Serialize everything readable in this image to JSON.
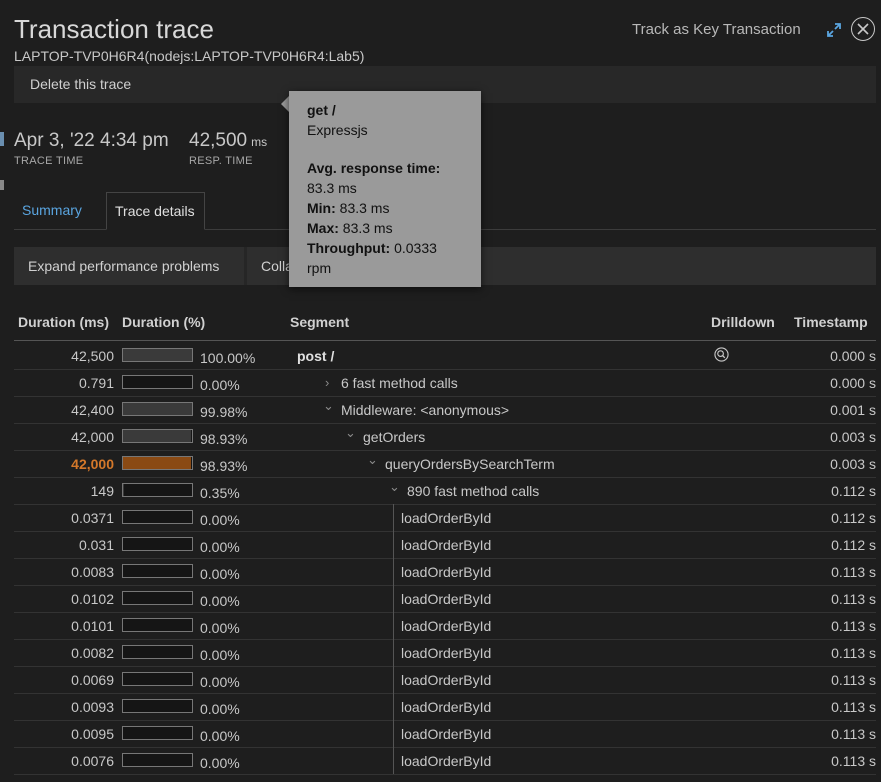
{
  "header": {
    "title": "Transaction trace",
    "subtitle": "LAPTOP-TVP0H6R4(nodejs:LAPTOP-TVP0H6R4:Lab5)",
    "track_label": "Track as Key Transaction",
    "delete_label": "Delete this trace"
  },
  "stats": {
    "trace_time": "Apr 3, '22 4:34 pm",
    "trace_time_label": "TRACE TIME",
    "resp_time": "42,500",
    "resp_time_unit": "ms",
    "resp_time_label": "RESP. TIME"
  },
  "tabs": {
    "summary": "Summary",
    "details": "Trace details"
  },
  "buttons": {
    "expand_perf": "Expand performance problems",
    "collapse": "Colla"
  },
  "columns": {
    "duration_ms": "Duration (ms)",
    "duration_pct": "Duration (%)",
    "segment": "Segment",
    "drilldown": "Drilldown",
    "timestamp": "Timestamp"
  },
  "tooltip": {
    "name": "get /",
    "framework": "Expressjs",
    "avg_label": "Avg. response time",
    "avg_value": "83.3 ms",
    "min_label": "Min",
    "min_value": "83.3 ms",
    "max_label": "Max",
    "max_value": "83.3 ms",
    "throughput_label": "Throughput",
    "throughput_value": "0.0333",
    "throughput_unit": "rpm"
  },
  "rows": [
    {
      "duration": "42,500",
      "pct": "100.00%",
      "fill": 1.0,
      "segment": "post /",
      "level": 0,
      "chevron": "",
      "bold": true,
      "drilldown": true,
      "timestamp": "0.000  s"
    },
    {
      "duration": "0.791",
      "pct": "0.00%",
      "fill": 0.0,
      "segment": "6 fast method calls",
      "level": 1,
      "chevron": "›",
      "timestamp": "0.000  s"
    },
    {
      "duration": "42,400",
      "pct": "99.98%",
      "fill": 0.9998,
      "segment": "Middleware: <anonymous>",
      "level": 1,
      "chevron": "⌄",
      "timestamp": "0.001  s"
    },
    {
      "duration": "42,000",
      "pct": "98.93%",
      "fill": 0.9893,
      "segment": "getOrders",
      "level": 2,
      "chevron": "⌄",
      "timestamp": "0.003  s"
    },
    {
      "duration": "42,000",
      "pct": "98.93%",
      "fill": 0.9893,
      "segment": "queryOrdersBySearchTerm",
      "level": 3,
      "chevron": "⌄",
      "highlight": true,
      "timestamp": "0.003  s"
    },
    {
      "duration": "149",
      "pct": "0.35%",
      "fill": 0.0035,
      "segment": "890 fast method calls",
      "level": 4,
      "chevron": "⌄",
      "timestamp": "0.112  s"
    },
    {
      "duration": "0.0371",
      "pct": "0.00%",
      "fill": 0.0,
      "segment": "loadOrderById",
      "level": 5,
      "chevron": "",
      "timestamp": "0.112  s"
    },
    {
      "duration": "0.031",
      "pct": "0.00%",
      "fill": 0.0,
      "segment": "loadOrderById",
      "level": 5,
      "chevron": "",
      "timestamp": "0.112  s"
    },
    {
      "duration": "0.0083",
      "pct": "0.00%",
      "fill": 0.0,
      "segment": "loadOrderById",
      "level": 5,
      "chevron": "",
      "timestamp": "0.113  s"
    },
    {
      "duration": "0.0102",
      "pct": "0.00%",
      "fill": 0.0,
      "segment": "loadOrderById",
      "level": 5,
      "chevron": "",
      "timestamp": "0.113  s"
    },
    {
      "duration": "0.0101",
      "pct": "0.00%",
      "fill": 0.0,
      "segment": "loadOrderById",
      "level": 5,
      "chevron": "",
      "timestamp": "0.113  s"
    },
    {
      "duration": "0.0082",
      "pct": "0.00%",
      "fill": 0.0,
      "segment": "loadOrderById",
      "level": 5,
      "chevron": "",
      "timestamp": "0.113  s"
    },
    {
      "duration": "0.0069",
      "pct": "0.00%",
      "fill": 0.0,
      "segment": "loadOrderById",
      "level": 5,
      "chevron": "",
      "timestamp": "0.113  s"
    },
    {
      "duration": "0.0093",
      "pct": "0.00%",
      "fill": 0.0,
      "segment": "loadOrderById",
      "level": 5,
      "chevron": "",
      "timestamp": "0.113  s"
    },
    {
      "duration": "0.0095",
      "pct": "0.00%",
      "fill": 0.0,
      "segment": "loadOrderById",
      "level": 5,
      "chevron": "",
      "timestamp": "0.113  s"
    },
    {
      "duration": "0.0076",
      "pct": "0.00%",
      "fill": 0.0,
      "segment": "loadOrderById",
      "level": 5,
      "chevron": "",
      "timestamp": "0.113  s"
    }
  ],
  "colors": {
    "accent": "#5aa5e0",
    "highlight": "#d4782a",
    "highlight_bar": "#8a4a14",
    "tooltip_bg": "#9a9a9a"
  }
}
